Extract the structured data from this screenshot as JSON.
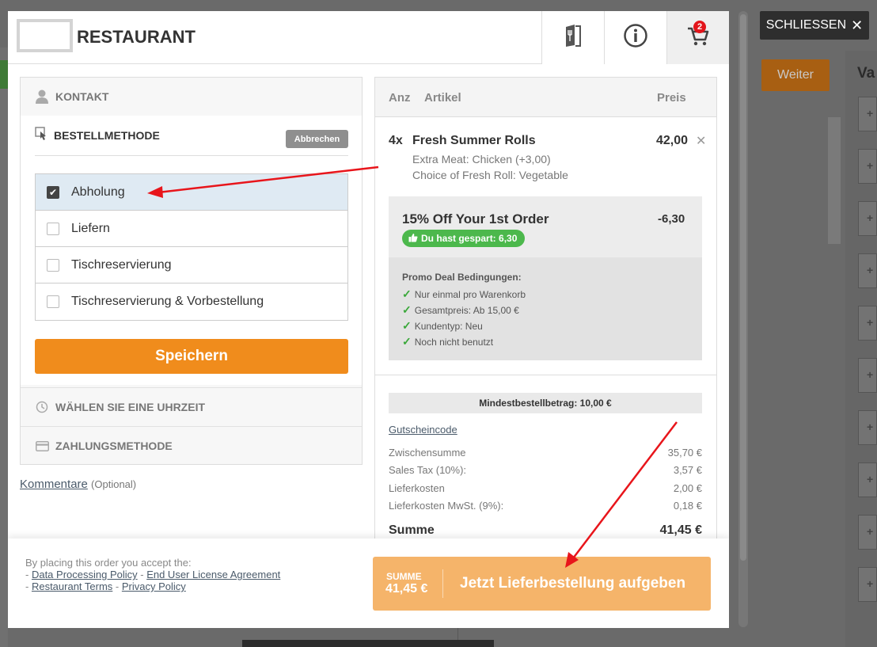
{
  "header": {
    "brand": "RESTAURANT",
    "cart_count": "2",
    "close_label": "SCHLIESSEN"
  },
  "background": {
    "weiter": "Weiter",
    "va": "Va"
  },
  "left": {
    "kontakt": "KONTAKT",
    "bestellmethode": "BESTELLMETHODE",
    "abbrechen": "Abbrechen",
    "options": [
      {
        "label": "Abholung",
        "checked": true
      },
      {
        "label": "Liefern",
        "checked": false
      },
      {
        "label": "Tischreservierung",
        "checked": false
      },
      {
        "label": "Tischreservierung & Vorbestellung",
        "checked": false
      }
    ],
    "speichern": "Speichern",
    "uhrzeit": "WÄHLEN SIE EINE UHRZEIT",
    "zahlung": "ZAHLUNGSMETHODE",
    "kommentare": "Kommentare",
    "optional": "(Optional)"
  },
  "cart": {
    "col_anz": "Anz",
    "col_artikel": "Artikel",
    "col_preis": "Preis",
    "item": {
      "qty": "4x",
      "name": "Fresh Summer Rolls",
      "price": "42,00",
      "opt1": "Extra Meat: Chicken (+3,00)",
      "opt2": "Choice of Fresh Roll: Vegetable"
    },
    "promo": {
      "title": "15% Off Your 1st Order",
      "amount": "-6,30",
      "saved": "Du hast gespart: 6,30",
      "cond_title": "Promo Deal Bedingungen:",
      "conds": [
        "Nur einmal pro Warenkorb",
        "Gesamtpreis: Ab 15,00 €",
        "Kundentyp: Neu",
        "Noch nicht benutzt"
      ]
    },
    "mindest": "Mindestbestellbetrag: 10,00 €",
    "gutschein": "Gutscheincode",
    "rows": [
      {
        "label": "Zwischensumme",
        "value": "35,70 €"
      },
      {
        "label": "Sales Tax (10%):",
        "value": "3,57 €"
      },
      {
        "label": "Lieferkosten",
        "value": "2,00 €"
      },
      {
        "label": "Lieferkosten MwSt. (9%):",
        "value": "0,18 €"
      }
    ],
    "total_label": "Summe",
    "total_value": "41,45 €"
  },
  "footer": {
    "intro": "By placing this order you accept the:",
    "link1": "Data Processing Policy",
    "link2": "End User License Agreement",
    "link3": "Restaurant Terms",
    "link4": "Privacy Policy",
    "sum_label": "SUMME",
    "sum_value": "41,45 €",
    "order_label": "Jetzt Lieferbestellung aufgeben"
  },
  "colors": {
    "accent": "#f08c1c",
    "order_button": "#f5b46a",
    "saved_badge": "#4cb84c",
    "annotation_arrow": "#e8151b"
  }
}
